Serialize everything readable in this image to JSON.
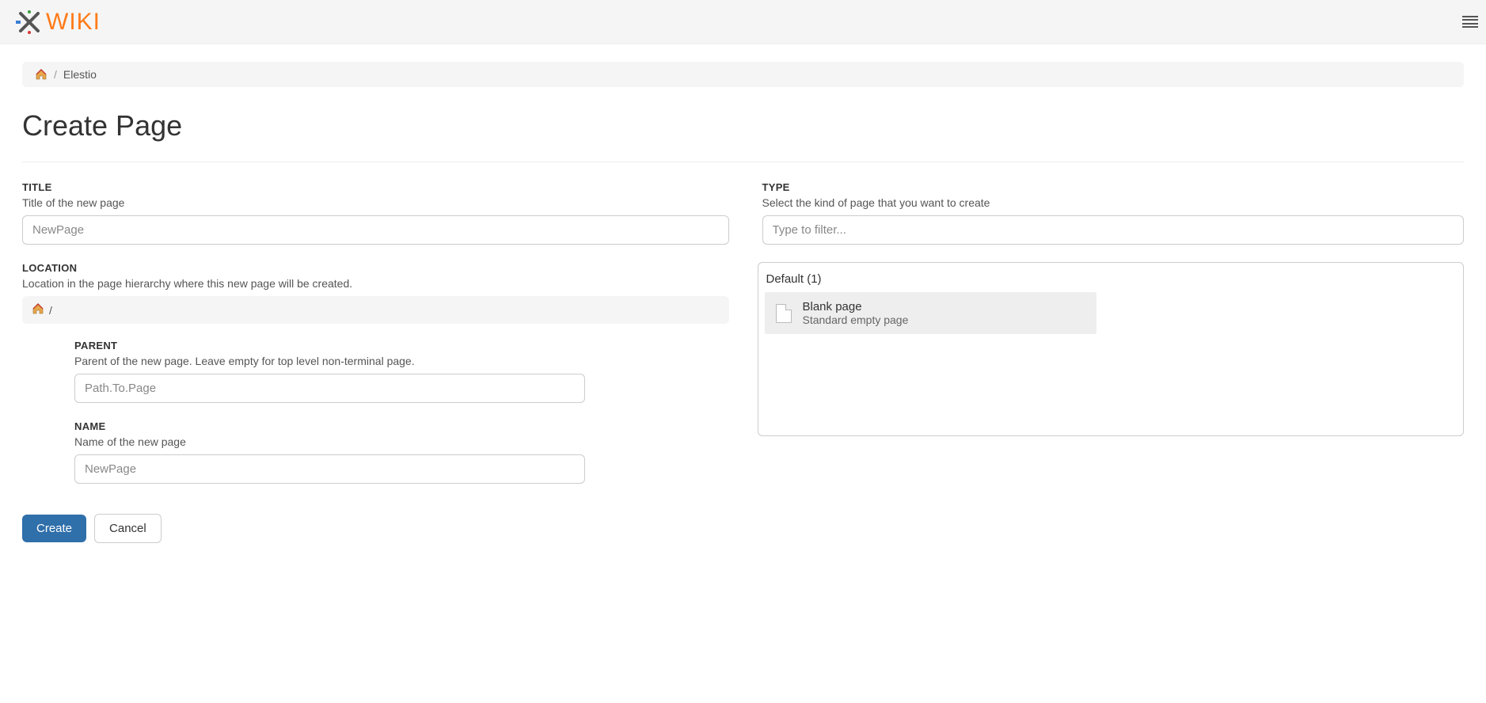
{
  "breadcrumb": {
    "current": "Elestio",
    "separator": "/"
  },
  "page": {
    "title": "Create Page"
  },
  "form": {
    "title": {
      "label": "TITLE",
      "desc": "Title of the new page",
      "placeholder": "NewPage",
      "value": ""
    },
    "location": {
      "label": "LOCATION",
      "desc": "Location in the page hierarchy where this new page will be created.",
      "path_display": "/"
    },
    "parent": {
      "label": "PARENT",
      "desc": "Parent of the new page. Leave empty for top level non-terminal page.",
      "placeholder": "Path.To.Page",
      "value": ""
    },
    "name": {
      "label": "NAME",
      "desc": "Name of the new page",
      "placeholder": "NewPage",
      "value": ""
    },
    "type": {
      "label": "TYPE",
      "desc": "Select the kind of page that you want to create",
      "filter_placeholder": "Type to filter...",
      "group_label": "Default (1)",
      "items": [
        {
          "title": "Blank page",
          "desc": "Standard empty page"
        }
      ]
    },
    "buttons": {
      "create": "Create",
      "cancel": "Cancel"
    }
  }
}
